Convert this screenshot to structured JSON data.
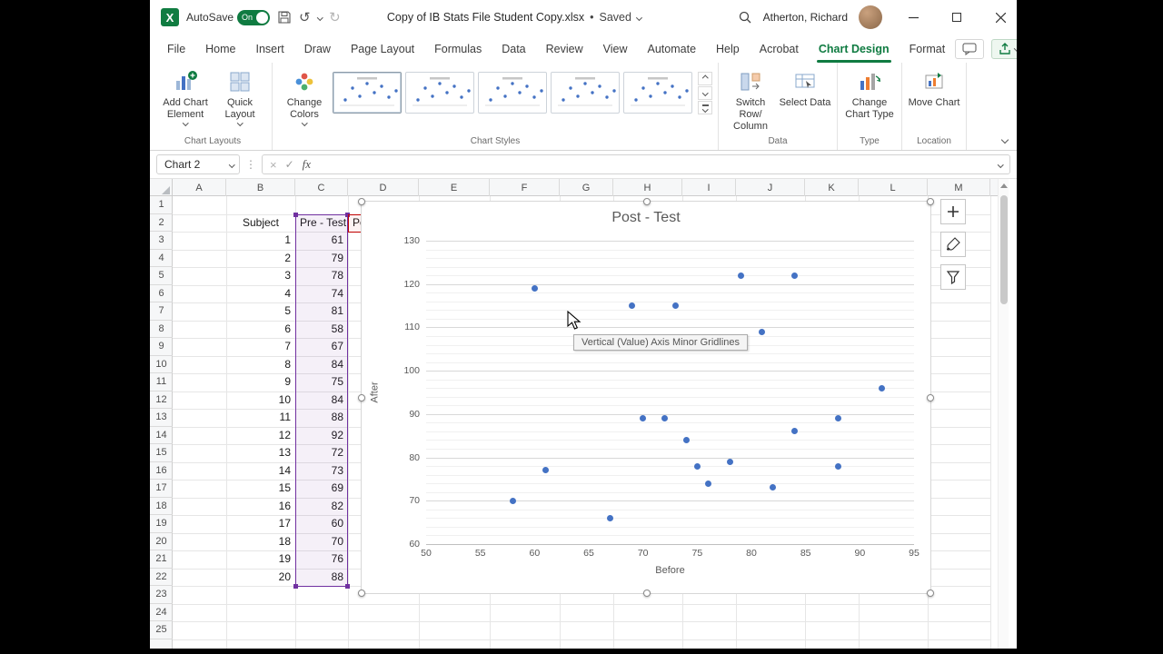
{
  "icons": {
    "undo": "↺",
    "redo": "↻",
    "ellipsis": "⋮",
    "cancel": "×",
    "check": "✓",
    "fx": "fx"
  },
  "title_bar": {
    "autosave_label": "AutoSave",
    "autosave_state": "On",
    "doc_title": "Copy of IB Stats File Student Copy.xlsx",
    "separator": "•",
    "doc_status": "Saved",
    "user_name": "Atherton, Richard"
  },
  "ribbon": {
    "tabs": [
      "File",
      "Home",
      "Insert",
      "Draw",
      "Page Layout",
      "Formulas",
      "Data",
      "Review",
      "View",
      "Automate",
      "Help",
      "Acrobat",
      "Chart Design",
      "Format"
    ],
    "active_tab": "Chart Design",
    "chart_layouts": {
      "group_label": "Chart Layouts",
      "add_chart_element": "Add Chart Element",
      "quick_layout": "Quick Layout"
    },
    "chart_styles": {
      "group_label": "Chart Styles",
      "change_colors": "Change Colors",
      "style_count": 5
    },
    "data_group": {
      "group_label": "Data",
      "switch_row_column": "Switch Row/ Column",
      "select_data": "Select Data"
    },
    "type_group": {
      "group_label": "Type",
      "change_chart_type": "Change Chart Type"
    },
    "location_group": {
      "group_label": "Location",
      "move_chart": "Move Chart"
    }
  },
  "formula_bar": {
    "name_box": "Chart 2"
  },
  "sheet": {
    "columns": [
      "A",
      "B",
      "C",
      "D",
      "E",
      "F",
      "G",
      "H",
      "I",
      "J",
      "K",
      "L",
      "M"
    ],
    "row_count": 25,
    "subject_header": "Subject",
    "pretest_header": "Pre - Test",
    "posttest_header_visible": "Po",
    "subjects": [
      1,
      2,
      3,
      4,
      5,
      6,
      7,
      8,
      9,
      10,
      11,
      12,
      13,
      14,
      15,
      16,
      17,
      18,
      19,
      20
    ],
    "pretest_values": [
      61,
      79,
      78,
      74,
      81,
      58,
      67,
      84,
      75,
      84,
      88,
      92,
      72,
      73,
      69,
      82,
      60,
      70,
      76,
      88
    ]
  },
  "chart_data": {
    "type": "scatter",
    "title": "Post - Test",
    "xlabel": "Before",
    "ylabel": "After",
    "xlim": [
      50,
      95
    ],
    "ylim": [
      60,
      130
    ],
    "x_ticks": [
      50,
      55,
      60,
      65,
      70,
      75,
      80,
      85,
      90,
      95
    ],
    "y_ticks": [
      60,
      70,
      80,
      90,
      100,
      110,
      120,
      130
    ],
    "minor_grid_step": 2,
    "major_grid_step": 10,
    "grid": true,
    "legend": false,
    "marker_color": "#4472c4",
    "points": [
      [
        58,
        70
      ],
      [
        60,
        119
      ],
      [
        61,
        77
      ],
      [
        67,
        66
      ],
      [
        69,
        115
      ],
      [
        70,
        89
      ],
      [
        72,
        89
      ],
      [
        73,
        115
      ],
      [
        74,
        84
      ],
      [
        75,
        78
      ],
      [
        76,
        74
      ],
      [
        78,
        79
      ],
      [
        79,
        122
      ],
      [
        81,
        109
      ],
      [
        82,
        73
      ],
      [
        84,
        86
      ],
      [
        84,
        122
      ],
      [
        88,
        78
      ],
      [
        88,
        89
      ],
      [
        92,
        96
      ]
    ],
    "tooltip": "Vertical (Value) Axis Minor Gridlines"
  }
}
